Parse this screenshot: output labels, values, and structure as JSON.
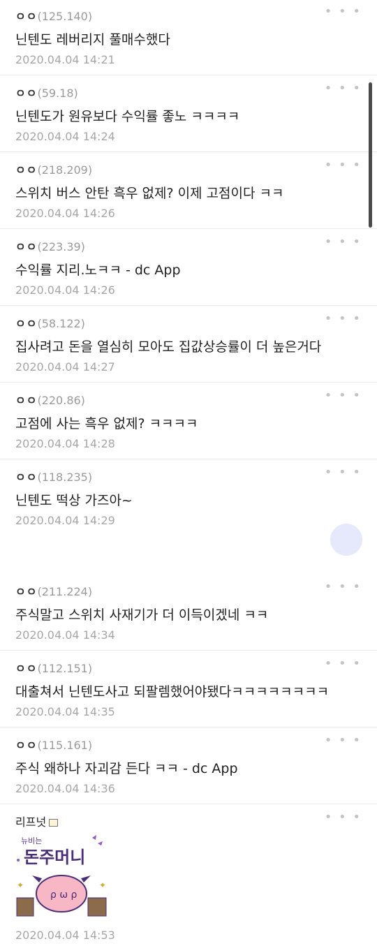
{
  "comments": [
    {
      "nick": "ㅇㅇ",
      "ip": "(125.140)",
      "text": "닌텐도 레버리지 풀매수했다",
      "date": "2020.04.04 14:21"
    },
    {
      "nick": "ㅇㅇ",
      "ip": "(59.18)",
      "text": "닌텐도가 원유보다 수익률 좋노 ㅋㅋㅋㅋ",
      "date": "2020.04.04 14:24"
    },
    {
      "nick": "ㅇㅇ",
      "ip": "(218.209)",
      "text": "스위치 버스 안탄 흑우 없제? 이제 고점이다 ㅋㅋ",
      "date": "2020.04.04 14:26"
    },
    {
      "nick": "ㅇㅇ",
      "ip": "(223.39)",
      "text": "수익률 지리.노ㅋㅋ - dc App",
      "date": "2020.04.04 14:26"
    },
    {
      "nick": "ㅇㅇ",
      "ip": "(58.122)",
      "text": "집사려고 돈을 열심히 모아도 집값상승률이 더 높은거다",
      "date": "2020.04.04 14:27"
    },
    {
      "nick": "ㅇㅇ",
      "ip": "(220.86)",
      "text": "고점에 사는 흑우 없제? ㅋㅋㅋㅋ",
      "date": "2020.04.04 14:28"
    },
    {
      "nick": "ㅇㅇ",
      "ip": "(118.235)",
      "text": "닌텐도 떡상 가즈아~",
      "date": "2020.04.04 14:29"
    },
    {
      "nick": "ㅇㅇ",
      "ip": "(211.224)",
      "text": "주식말고 스위치 사재기가 더 이득이겠네 ㅋㅋ",
      "date": "2020.04.04 14:34"
    },
    {
      "nick": "ㅇㅇ",
      "ip": "(112.151)",
      "text": "대출쳐서 닌텐도사고 되팔렘했어야됐다ㅋㅋㅋㅋㅋㅋㅋㅋ",
      "date": "2020.04.04 14:35"
    },
    {
      "nick": "ㅇㅇ",
      "ip": "(115.161)",
      "text": "주식 왜하나 자괴감 든다 ㅋㅋ - dc App",
      "date": "2020.04.04 14:36"
    }
  ],
  "last_comment": {
    "nick": "리프넛",
    "sticker_text_top": "뉴비는",
    "sticker_text_main": "돈주머니",
    "date": "2020.04.04 14:53"
  },
  "more_label": "• • •"
}
